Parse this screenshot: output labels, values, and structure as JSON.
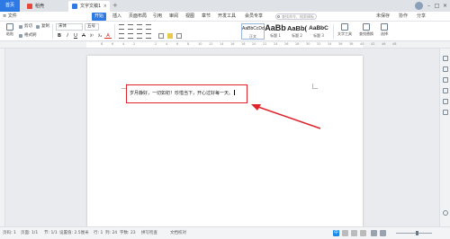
{
  "titlebar": {
    "home_label": "首页",
    "tabs": [
      {
        "label": "稻壳"
      },
      {
        "label": "文字文稿1"
      }
    ],
    "close_glyph": "×",
    "new_tab_glyph": "+",
    "window_controls": [
      "–",
      "□",
      "×"
    ]
  },
  "menubar": {
    "file": "≡ 文件",
    "items": [
      "开始",
      "插入",
      "页面布局",
      "引用",
      "审阅",
      "视图",
      "章节",
      "开发工具",
      "会员专享"
    ],
    "active": "开始",
    "search_placeholder": "查找命令、搜索模板",
    "right": [
      "未保存",
      "协作",
      "分享"
    ]
  },
  "ribbon": {
    "paste": "粘贴",
    "cut": "剪切",
    "copy": "复制",
    "format_painter": "格式刷",
    "font_name": "宋体",
    "font_size": "五号",
    "format_buttons": [
      "B",
      "I",
      "U",
      "A",
      "X²",
      "X₂",
      "A"
    ],
    "styles": [
      {
        "sample": "AaBbCcDd",
        "label": "正文"
      },
      {
        "sample": "AaBb",
        "label": "标题 1"
      },
      {
        "sample": "AaBb(",
        "label": "标题 2"
      },
      {
        "sample": "AaBbC",
        "label": "标题 3"
      }
    ],
    "text_tools": "文字工具",
    "find_replace": "查找替换",
    "select": "选择"
  },
  "ruler_numbers": [
    "8",
    "6",
    "4",
    "2",
    "",
    "2",
    "4",
    "6",
    "8",
    "10",
    "12",
    "14",
    "16",
    "18",
    "20",
    "22",
    "24",
    "26",
    "28",
    "30",
    "32",
    "34",
    "36",
    "38",
    "40",
    "42",
    "46",
    "48"
  ],
  "document": {
    "text": "岁月静好，一切如初！珍惜当下，开心过好每一天。"
  },
  "statusbar": {
    "page": "页码: 1",
    "pages": "页面: 1/1",
    "section": "节: 1/1",
    "setting": "设置值: 2.5厘米",
    "row": "行: 1",
    "col": "列: 24",
    "words": "字数: 23",
    "spell": "拼写检查",
    "proof": "文档校对",
    "ime": "中"
  },
  "colors": {
    "accent": "#2d7ae5",
    "annotation": "#e0222a"
  }
}
